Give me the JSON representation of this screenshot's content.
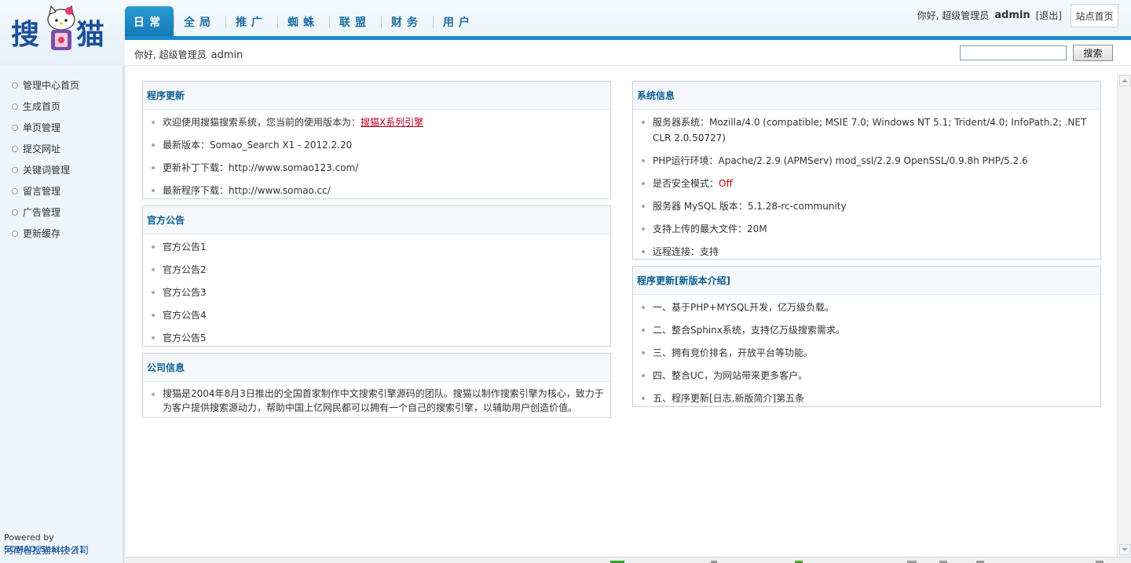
{
  "logo": {
    "char1": "搜",
    "char2": "猫"
  },
  "nav": {
    "items": [
      {
        "label": "日常",
        "active": true
      },
      {
        "label": "全局",
        "active": false
      },
      {
        "label": "推广",
        "active": false
      },
      {
        "label": "蜘蛛",
        "active": false
      },
      {
        "label": "联盟",
        "active": false
      },
      {
        "label": "财务",
        "active": false
      },
      {
        "label": "用户",
        "active": false
      }
    ]
  },
  "top_user": {
    "greeting": "你好, 超级管理员",
    "name": "admin",
    "logout": "[退出]",
    "site_home": "站点首页"
  },
  "subbar": {
    "greeting": "你好, 超级管理员",
    "name": "admin",
    "search_placeholder": "",
    "search_button": "搜索"
  },
  "sidebar": {
    "items": [
      "管理中心首页",
      "生成首页",
      "单页管理",
      "提交网址",
      "关键词管理",
      "留言管理",
      "广告管理",
      "更新缓存"
    ],
    "powered_prefix": "Powered by ",
    "powered_product": "SOMAO_Search X1",
    "company": "河南省搜猫科技公司"
  },
  "panels": {
    "update": {
      "title": "程序更新",
      "welcome": "欢迎使用搜猫搜索系统，您当前的使用版本为：",
      "welcome_link": "搜猫X系列引擎",
      "latest_version": "最新版本：Somao_Search X1 - 2012.2.20",
      "patch": "更新补丁下载：http://www.somao123.com/",
      "program": "最新程序下载：http://www.somao.cc/"
    },
    "announce": {
      "title": "官方公告",
      "items": [
        "官方公告1",
        "官方公告2",
        "官方公告3",
        "官方公告4",
        "官方公告5"
      ]
    },
    "company": {
      "title": "公司信息",
      "text": "搜猫是2004年8月3日推出的全国首家制作中文搜索引擎源码的团队。搜猫以制作搜索引擎为核心，致力于为客户提供搜索源动力，帮助中国上亿网民都可以拥有一个自己的搜索引擎，以辅助用户创造价值。"
    },
    "sysinfo": {
      "title": "系统信息",
      "server_os": "服务器系统：Mozilla/4.0 (compatible; MSIE 7.0; Windows NT 5.1; Trident/4.0; InfoPath.2; .NET CLR 2.0.50727)",
      "php_env": "PHP运行环境：Apache/2.2.9 (APMServ) mod_ssl/2.2.9 OpenSSL/0.9.8h PHP/5.2.6",
      "safe_mode_label": "是否安全模式：",
      "safe_mode_value": "Off",
      "mysql": "服务器 MySQL 版本：5.1.28-rc-community",
      "max_upload": "支持上传的最大文件：20M",
      "remote": "远程连接：支持"
    },
    "features": {
      "title": "程序更新[新版本介绍]",
      "items": [
        "一、基于PHP+MYSQL开发，亿万级负载。",
        "二、整合Sphinx系统，支持亿万级搜索需求。",
        "三、拥有竞价排名，开放平台等功能。",
        "四、整合UC，为网站带来更多客户。",
        "五、程序更新[日志,新版简介]第五条"
      ]
    }
  },
  "colors": {
    "accent_blue": "#1b8ccb",
    "title_blue": "#0e5e93",
    "link_red": "#b8001f"
  }
}
